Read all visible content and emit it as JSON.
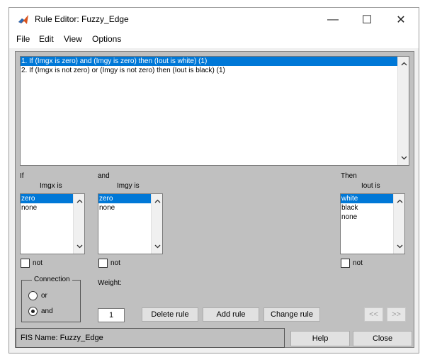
{
  "window": {
    "title": "Rule Editor: Fuzzy_Edge",
    "minimize_glyph": "—",
    "maximize_glyph": "☐",
    "close_glyph": "✕"
  },
  "menu": {
    "items": [
      {
        "label": "File"
      },
      {
        "label": "Edit"
      },
      {
        "label": "View"
      },
      {
        "label": "Options"
      }
    ]
  },
  "rules": {
    "items": [
      {
        "text": "1. If (Imgx is zero) and (Imgy is zero) then (Iout is white) (1)",
        "selected": true
      },
      {
        "text": "2. If (Imgx is not zero) or (Imgy is not zero) then (Iout is black) (1)",
        "selected": false
      }
    ]
  },
  "antecedent1": {
    "prefix": "If",
    "label": "Imgx is",
    "options": [
      {
        "text": "zero",
        "selected": true
      },
      {
        "text": "none",
        "selected": false
      }
    ],
    "not_label": "not"
  },
  "antecedent2": {
    "prefix": "and",
    "label": "Imgy is",
    "options": [
      {
        "text": "zero",
        "selected": true
      },
      {
        "text": "none",
        "selected": false
      }
    ],
    "not_label": "not"
  },
  "consequent": {
    "prefix": "Then",
    "label": "Iout is",
    "options": [
      {
        "text": "white",
        "selected": true
      },
      {
        "text": "black",
        "selected": false
      },
      {
        "text": "none",
        "selected": false
      }
    ],
    "not_label": "not"
  },
  "connection": {
    "title": "Connection",
    "or_label": "or",
    "and_label": "and",
    "selected": "and"
  },
  "weight": {
    "label": "Weight:",
    "value": "1"
  },
  "buttons": {
    "delete_rule": "Delete rule",
    "add_rule": "Add rule",
    "change_rule": "Change rule",
    "prev": "<<",
    "next": ">>",
    "help": "Help",
    "close": "Close"
  },
  "status": {
    "text": "FIS Name: Fuzzy_Edge"
  },
  "colors": {
    "selection": "#0078d7",
    "panel_bg": "#c0c0c0"
  }
}
